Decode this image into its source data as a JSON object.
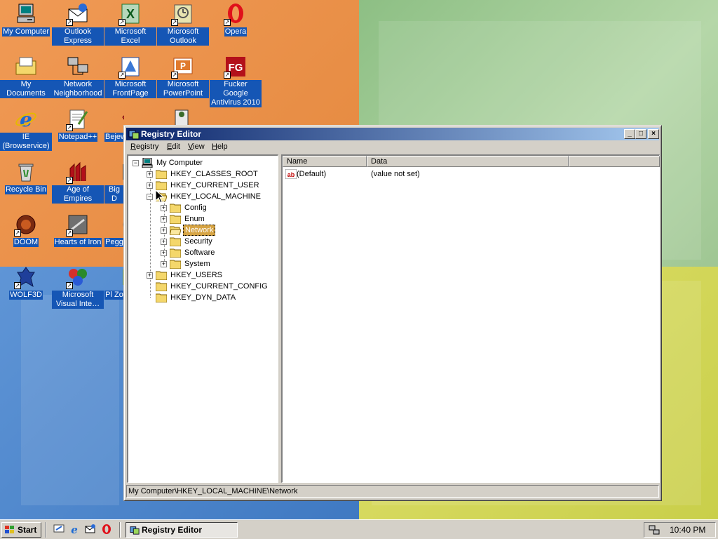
{
  "desktop": {
    "icons": [
      {
        "label": "My Computer",
        "icon": "my-computer-icon"
      },
      {
        "label": "Outlook Express",
        "icon": "outlook-express-icon"
      },
      {
        "label": "Microsoft Excel",
        "icon": "excel-icon"
      },
      {
        "label": "Microsoft Outlook",
        "icon": "outlook-icon"
      },
      {
        "label": "Opera",
        "icon": "opera-icon"
      },
      {
        "label": "My Documents",
        "icon": "my-documents-icon"
      },
      {
        "label": "Network Neighborhood",
        "icon": "network-neighborhood-icon"
      },
      {
        "label": "Microsoft FrontPage",
        "icon": "frontpage-icon"
      },
      {
        "label": "Microsoft PowerPoint",
        "icon": "powerpoint-icon"
      },
      {
        "label": "Fucker Google Antivirus 2010",
        "icon": "fg-antivirus-icon"
      },
      {
        "label": "IE (Browservice)",
        "icon": "internet-explorer-icon"
      },
      {
        "label": "Notepad++",
        "icon": "notepad-plus-plus-icon"
      },
      {
        "label": "Bejeweled",
        "icon": "bejeweled-icon"
      },
      {
        "label": "Recycle Bin",
        "icon": "recycle-bin-icon"
      },
      {
        "label": "Age of Empires",
        "icon": "age-of-empires-icon"
      },
      {
        "label": "Big D",
        "icon": "big-d-icon"
      },
      {
        "label": "DOOM",
        "icon": "doom-icon"
      },
      {
        "label": "Hearts of Iron",
        "icon": "hearts-of-iron-icon"
      },
      {
        "label": "Pegg",
        "icon": "pegg-icon"
      },
      {
        "label": "WOLF3D",
        "icon": "wolf3d-icon"
      },
      {
        "label": "Microsoft Visual Inte…",
        "icon": "visual-interdev-icon"
      },
      {
        "label": "Pl Zo",
        "icon": "pl-zo-icon"
      }
    ]
  },
  "window": {
    "title": "Registry Editor",
    "controls": {
      "minimize": "_",
      "maximize": "□",
      "close": "×"
    },
    "menu": [
      {
        "key": "R",
        "rest": "egistry"
      },
      {
        "key": "E",
        "rest": "dit"
      },
      {
        "key": "V",
        "rest": "iew"
      },
      {
        "key": "H",
        "rest": "elp"
      }
    ],
    "tree": {
      "root": "My Computer",
      "nodes": [
        {
          "label": "HKEY_CLASSES_ROOT",
          "exp": "+"
        },
        {
          "label": "HKEY_CURRENT_USER",
          "exp": "+"
        },
        {
          "label": "HKEY_LOCAL_MACHINE",
          "exp": "−"
        },
        {
          "label": "Config",
          "exp": "+"
        },
        {
          "label": "Enum",
          "exp": "+"
        },
        {
          "label": "Network",
          "exp": "+"
        },
        {
          "label": "Security",
          "exp": "+"
        },
        {
          "label": "Software",
          "exp": "+"
        },
        {
          "label": "System",
          "exp": "+"
        },
        {
          "label": "HKEY_USERS",
          "exp": "+"
        },
        {
          "label": "HKEY_CURRENT_CONFIG",
          "exp": ""
        },
        {
          "label": "HKEY_DYN_DATA",
          "exp": ""
        }
      ]
    },
    "list": {
      "columns": [
        "Name",
        "Data"
      ],
      "rows": [
        {
          "name": "(Default)",
          "data": "(value not set)",
          "icon": "string-value-icon"
        }
      ]
    },
    "status": "My Computer\\HKEY_LOCAL_MACHINE\\Network"
  },
  "taskbar": {
    "start": "Start",
    "task": "Registry Editor",
    "clock": "10:40 PM",
    "quick_launch": [
      "show-desktop-icon",
      "internet-explorer-icon",
      "outlook-express-icon",
      "opera-icon"
    ]
  }
}
